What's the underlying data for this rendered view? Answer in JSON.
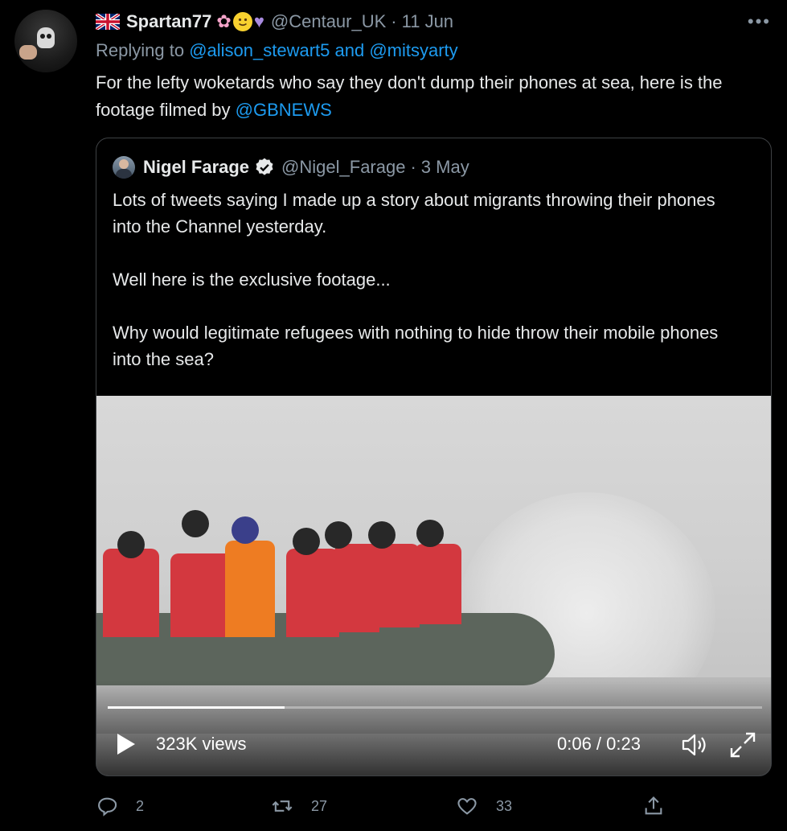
{
  "tweet": {
    "author_name": "Spartan77",
    "author_handle": "@Centaur_UK",
    "date": "11 Jun",
    "replying_prefix": "Replying to",
    "replying_to": "@alison_stewart5 and @mitsyarty",
    "text": "For the lefty woketards who say they don't dump their phones at sea, here is the footage filmed by ",
    "mention": "@GBNEWS",
    "more": "•••"
  },
  "quote": {
    "author_name": "Nigel Farage",
    "author_handle": "@Nigel_Farage",
    "date": "3 May",
    "paragraphs": [
      "Lots of tweets saying I made up a story about migrants throwing their phones into the Channel yesterday.",
      "Well here is the exclusive footage...",
      "Why would legitimate refugees with nothing to hide throw their mobile phones into the sea?"
    ],
    "video": {
      "views": "323K views",
      "time": "0:06 / 0:23",
      "progress_fraction": 0.27
    }
  },
  "actions": {
    "replies": "2",
    "retweets": "27",
    "likes": "33"
  },
  "colors": {
    "background": "#000000",
    "text": "#e7e9ea",
    "muted": "#8b98a5",
    "link": "#1d9bf0",
    "border": "#3e4144"
  }
}
